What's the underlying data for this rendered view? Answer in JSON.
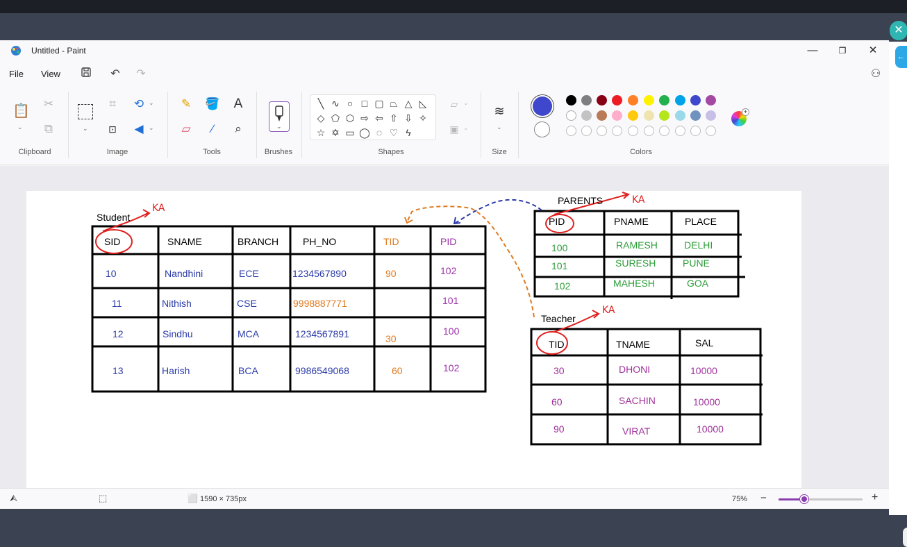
{
  "window": {
    "title": "Untitled - Paint",
    "controls": {
      "minimize": "—",
      "maximize": "❐",
      "close": "✕"
    }
  },
  "menu": {
    "file": "File",
    "view": "View"
  },
  "ribbon": {
    "groups": [
      "Clipboard",
      "Image",
      "Tools",
      "Brushes",
      "Shapes",
      "Size",
      "Colors"
    ]
  },
  "colors": {
    "primary": "#3f48cc",
    "secondary": "#ffffff",
    "palette_row1": [
      "#000000",
      "#7f7f7f",
      "#880015",
      "#ed1c24",
      "#ff7f27",
      "#fff200",
      "#22b14c",
      "#00a2e8",
      "#3f48cc",
      "#a349a4"
    ],
    "palette_row2": [
      "#ffffff",
      "#c3c3c3",
      "#b97a57",
      "#ffaec9",
      "#ffc90e",
      "#efe4b0",
      "#b5e61d",
      "#99d9ea",
      "#7092be",
      "#c8bfe7"
    ]
  },
  "drawing": {
    "student": {
      "title": "Student",
      "ka": "KA",
      "headers": [
        "SID",
        "SNAME",
        "BRANCH",
        "PH_NO",
        "TID",
        "PID"
      ],
      "rows": [
        [
          "10",
          "Nandhini",
          "ECE",
          "1234567890",
          "90",
          "102"
        ],
        [
          "11",
          "Nithish",
          "CSE",
          "9998887771",
          "",
          "101"
        ],
        [
          "12",
          "Sindhu",
          "MCA",
          "1234567891",
          "30",
          "100"
        ],
        [
          "13",
          "Harish",
          "BCA",
          "9986549068",
          "60",
          "102"
        ]
      ]
    },
    "parents": {
      "title": "PARENTS",
      "ka": "KA",
      "headers": [
        "PID",
        "PNAME",
        "PLACE"
      ],
      "rows": [
        [
          "100",
          "RAMESH",
          "DELHI"
        ],
        [
          "101",
          "SURESH",
          "PUNE"
        ],
        [
          "102",
          "MAHESH",
          "GOA"
        ]
      ]
    },
    "teacher": {
      "title": "Teacher",
      "ka": "KA",
      "headers": [
        "TID",
        "TNAME",
        "SAL"
      ],
      "rows": [
        [
          "30",
          "DHONI",
          "10000"
        ],
        [
          "60",
          "SACHIN",
          "10000"
        ],
        [
          "90",
          "VIRAT",
          "10000"
        ]
      ]
    }
  },
  "status": {
    "canvas_size": "1590 × 735px",
    "zoom": "75%",
    "zoom_level": 0.3
  }
}
